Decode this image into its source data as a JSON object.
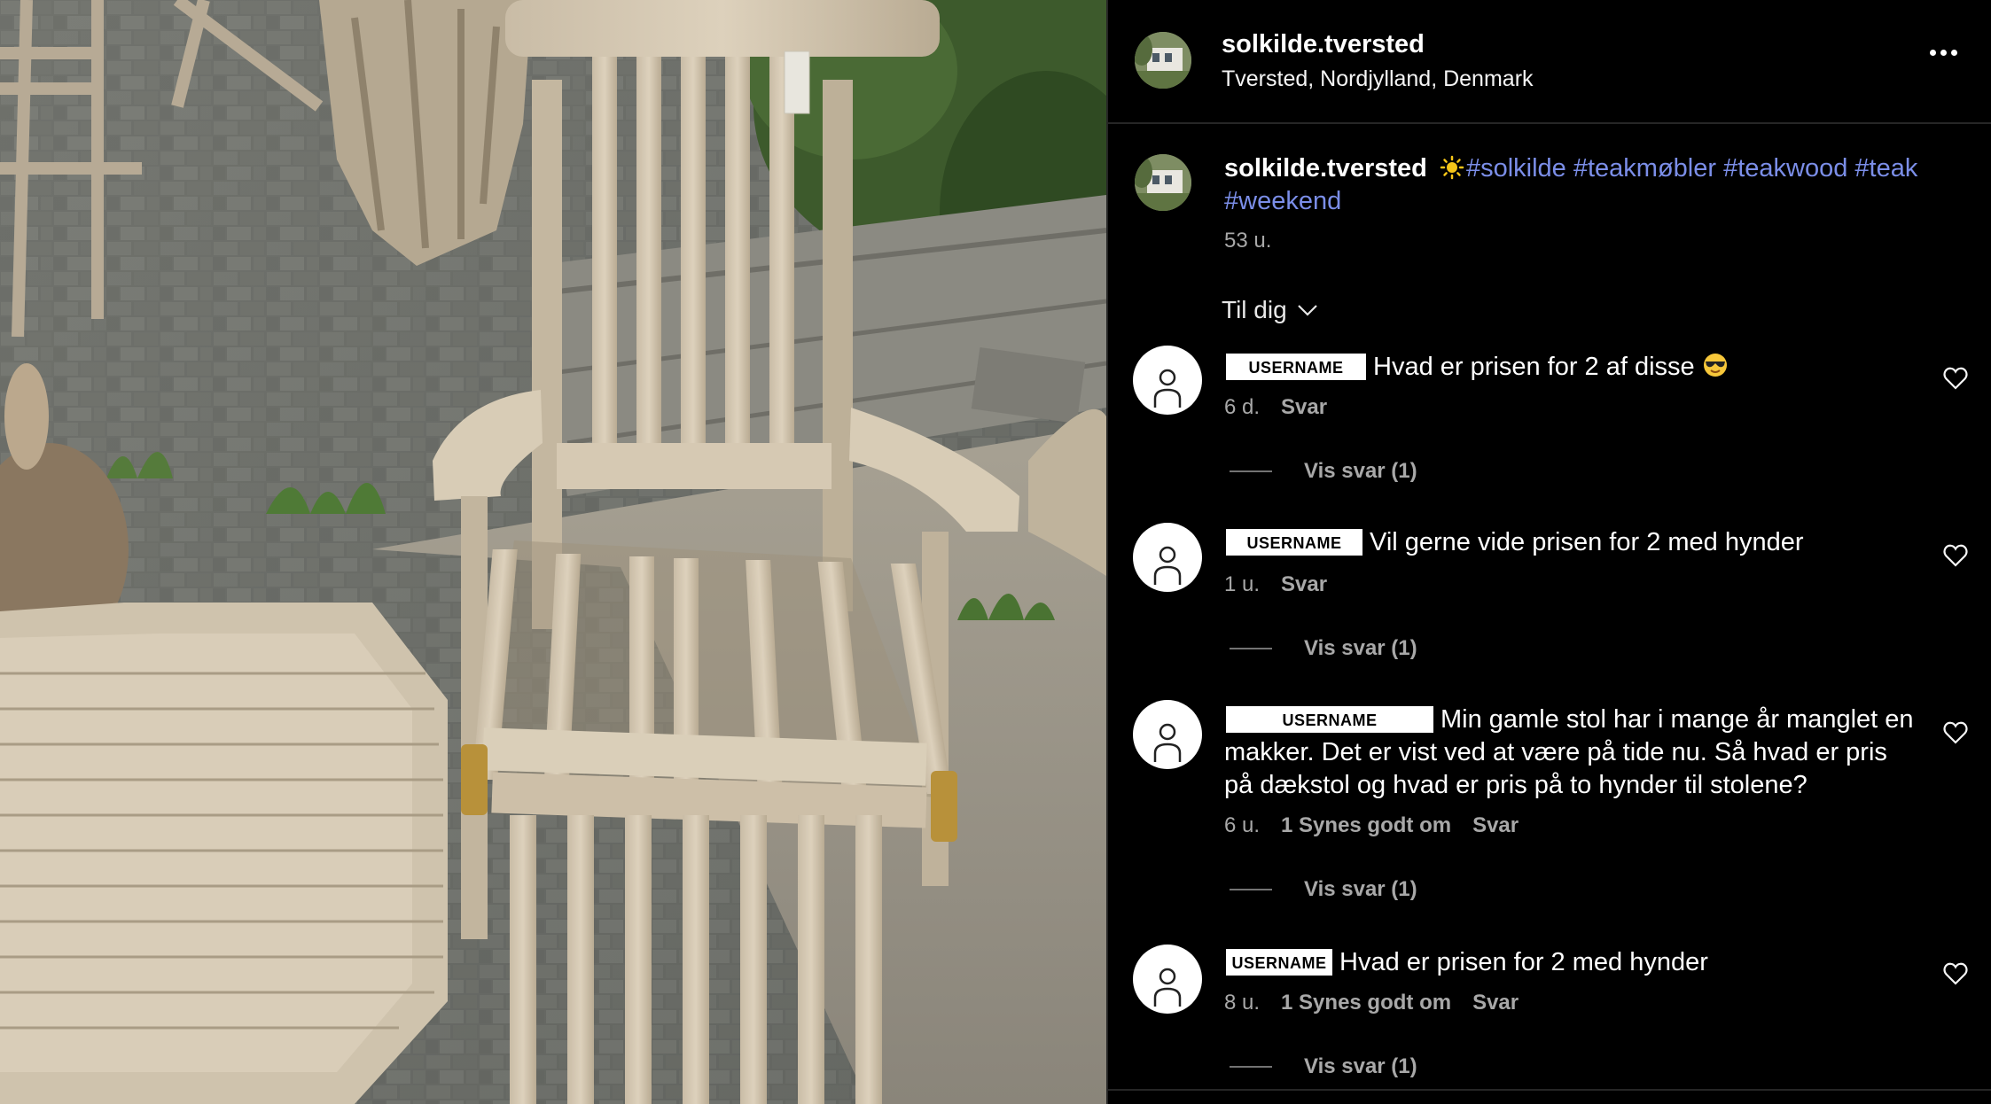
{
  "post": {
    "username": "solkilde.tversted",
    "location": "Tversted, Nordjylland, Denmark",
    "caption_username": "solkilde.tversted",
    "hashtags": [
      "#solkilde",
      "#teakmøbler",
      "#teakwood",
      "#teak",
      "#weekend"
    ],
    "time": "53 u."
  },
  "sort": {
    "label": "Til dig"
  },
  "comments": [
    {
      "username": "USERNAME",
      "text": "Hvad er prisen for 2 af disse",
      "emoji": "smiling-face-with-sunglasses",
      "time": "6 d.",
      "likes": "",
      "reply": "Svar",
      "replies": "Vis svar (1)"
    },
    {
      "username": "USERNAME",
      "text": "Vil gerne vide prisen for 2 med hynder",
      "time": "1 u.",
      "likes": "",
      "reply": "Svar",
      "replies": "Vis svar (1)"
    },
    {
      "username": "USERNAME",
      "text": "Min gamle stol har i mange år manglet en makker. Det er vist ved at være på tide nu. Så hvad er pris på dækstol og hvad er pris på to hynder til stolene?",
      "time": "6 u.",
      "likes": "1 Synes godt om",
      "reply": "Svar",
      "replies": "Vis svar (1)"
    },
    {
      "username": "USERNAME",
      "text": "Hvad er prisen for 2 med hynder",
      "time": "8 u.",
      "likes": "1 Synes godt om",
      "reply": "Svar",
      "replies": "Vis svar (1)"
    }
  ],
  "icons": {
    "more": "more-horizontal-icon",
    "chevron": "chevron-down-icon",
    "heart": "heart-outline-icon",
    "avatar": "default-avatar-icon",
    "sun": "sun-emoji-icon"
  },
  "colors": {
    "background": "#000000",
    "hashtag": "#7b8ee8",
    "secondary_text": "#a8a8a8",
    "divider": "#262626"
  }
}
